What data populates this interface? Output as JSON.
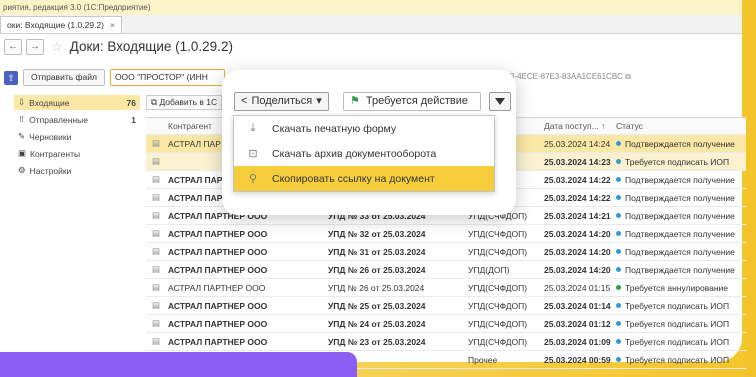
{
  "window": {
    "title": "риятия, редакция 3.0  (1С:Предприятие)",
    "tab_label": "оки: Входящие (1.0.29.2)",
    "tab_close": "×",
    "doc_title": "Доки: Входящие (1.0.29.2)"
  },
  "toolbar": {
    "back": "←",
    "forward": "→",
    "star": "☆",
    "send_file_label": "Отправить файл",
    "org_value": "ООО \"ПРОСТОР\" (ИНН",
    "guid": "3-4ECE-87E3-83AA1CE61CBC",
    "add_label": "Добавить в 1С"
  },
  "sidebar": {
    "items": [
      {
        "icon": "inbox-icon",
        "label": "Входящие",
        "count": "76"
      },
      {
        "icon": "outbox-icon",
        "label": "Отправленные",
        "count": "1"
      },
      {
        "icon": "pencil-icon",
        "label": "Черновики",
        "count": ""
      },
      {
        "icon": "contacts-icon",
        "label": "Контрагенты",
        "count": ""
      },
      {
        "icon": "gear-icon",
        "label": "Настройки",
        "count": ""
      }
    ]
  },
  "table": {
    "headers": {
      "contractor": "Контрагент",
      "doc": "",
      "type": "кумента",
      "date": "Дата поступ...  ↑",
      "status": "Статус"
    },
    "rows": [
      {
        "contractor": "АСТРАЛ ПАР",
        "doc": "",
        "type": "1)",
        "date": "25.03.2024 14:24",
        "status": "Подтверждается получение",
        "status_color": "#2f9bd6",
        "bold": false,
        "style": "sel"
      },
      {
        "contractor": "",
        "doc": "",
        "type": "Ю)",
        "date": "25.03.2024 14:23",
        "status": "Требуется подписать ИОП",
        "status_color": "#2f9bd6",
        "bold": true,
        "style": "sel2"
      },
      {
        "contractor": "АСТРАЛ ПАР",
        "doc": "",
        "type": "ФДОП)",
        "date": "25.03.2024 14:22",
        "status": "Подтверждается получение",
        "status_color": "#2f9bd6",
        "bold": true,
        "style": ""
      },
      {
        "contractor": "АСТРАЛ ПАР",
        "doc": "",
        "type": "1)",
        "date": "25.03.2024 14:22",
        "status": "Подтверждается получение",
        "status_color": "#2f9bd6",
        "bold": true,
        "style": ""
      },
      {
        "contractor": "АСТРАЛ ПАРТНЕР ООО",
        "doc": "УПД № 33 от 25.03.2024",
        "type": "УПД(СЧФДОП)",
        "date": "25.03.2024 14:21",
        "status": "Подтверждается получение",
        "status_color": "#2f9bd6",
        "bold": true,
        "style": ""
      },
      {
        "contractor": "АСТРАЛ ПАРТНЕР ООО",
        "doc": "УПД № 32 от 25.03.2024",
        "type": "УПД(СЧФДОП)",
        "date": "25.03.2024 14:20",
        "status": "Подтверждается получение",
        "status_color": "#2f9bd6",
        "bold": true,
        "style": ""
      },
      {
        "contractor": "АСТРАЛ ПАРТНЕР ООО",
        "doc": "УПД № 31 от 25.03.2024",
        "type": "УПД(СЧФДОП)",
        "date": "25.03.2024 14:20",
        "status": "Подтверждается получение",
        "status_color": "#2f9bd6",
        "bold": true,
        "style": ""
      },
      {
        "contractor": "АСТРАЛ ПАРТНЕР ООО",
        "doc": "УПД № 26 от 25.03.2024",
        "type": "УПД(ДОП)",
        "date": "25.03.2024 14:20",
        "status": "Подтверждается получение",
        "status_color": "#2f9bd6",
        "bold": true,
        "style": ""
      },
      {
        "contractor": "АСТРАЛ ПАРТНЕР ООО",
        "doc": "УПД № 26 от 25.03.2024",
        "type": "УПД(СЧФДОП)",
        "date": "25.03.2024 01:15",
        "status": "Требуется аннулирование",
        "status_color": "#2fa04a",
        "bold": false,
        "style": ""
      },
      {
        "contractor": "АСТРАЛ ПАРТНЕР ООО",
        "doc": "УПД № 25 от 25.03.2024",
        "type": "УПД(СЧФДОП)",
        "date": "25.03.2024 01:14",
        "status": "Требуется подписать ИОП",
        "status_color": "#2f9bd6",
        "bold": true,
        "style": ""
      },
      {
        "contractor": "АСТРАЛ ПАРТНЕР ООО",
        "doc": "УПД № 24 от 25.03.2024",
        "type": "УПД(СЧФДОП)",
        "date": "25.03.2024 01:12",
        "status": "Требуется подписать ИОП",
        "status_color": "#2f9bd6",
        "bold": true,
        "style": ""
      },
      {
        "contractor": "АСТРАЛ ПАРТНЕР ООО",
        "doc": "УПД № 23 от 25.03.2024",
        "type": "УПД(СЧФДОП)",
        "date": "25.03.2024 01:09",
        "status": "Требуется подписать ИОП",
        "status_color": "#2f9bd6",
        "bold": true,
        "style": ""
      },
      {
        "contractor": "",
        "doc": "",
        "type": "Прочее",
        "date": "25.03.2024 00:59",
        "status": "Требуется подписать ИОП",
        "status_color": "#2f9bd6",
        "bold": true,
        "style": ""
      }
    ]
  },
  "popup": {
    "share_label": "Поделиться",
    "share_caret": "▾",
    "action_label": "Требуется действие",
    "menu": [
      {
        "icon": "download-icon",
        "glyph": "⤓",
        "label": "Скачать печатную форму"
      },
      {
        "icon": "archive-icon",
        "glyph": "⊡",
        "label": "Скачать архив документооборота"
      },
      {
        "icon": "link-icon",
        "glyph": "⚲",
        "label": "Скопировать ссылку на документ"
      }
    ],
    "ghost_text": "Е"
  },
  "colors": {
    "accent_yellow": "#f6ce3d",
    "selected_row": "#fbe8a6",
    "purple_banner": "#8d5cf0",
    "flag_green": "#2fa04a"
  }
}
